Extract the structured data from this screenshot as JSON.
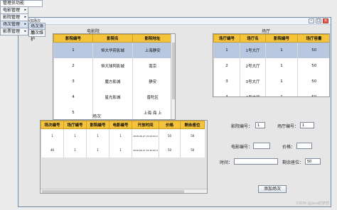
{
  "app_menu": {
    "title": "管理员功能",
    "items": [
      {
        "label": "电影管理",
        "has_sub": true
      },
      {
        "label": "影院管理",
        "has_sub": true
      },
      {
        "label": "场次管理",
        "has_sub": true
      },
      {
        "label": "影票管理",
        "has_sub": true
      }
    ],
    "submenu": [
      "场次添加",
      "场次维护"
    ]
  },
  "window": {
    "title": "添加场次"
  },
  "cinema_section": {
    "label": "电影院",
    "headers": [
      "影院编号",
      "影院名",
      "影院地址"
    ],
    "rows": [
      [
        "1",
        "恒大华府影城",
        "上海静安"
      ],
      [
        "2",
        "恒大球阿影城",
        "南京"
      ],
      [
        "3",
        "魔方影城",
        "静安"
      ],
      [
        "4",
        "星光影城",
        "普陀区"
      ],
      [
        "5",
        "",
        "上海 海 上"
      ]
    ],
    "selected_row": 0
  },
  "hall_section": {
    "label": "场厅",
    "headers": [
      "场厅编号",
      "场厅名",
      "影院编号",
      "场厅容量"
    ],
    "rows": [
      [
        "1",
        "1号大厅",
        "1",
        "50"
      ],
      [
        "2",
        "2号大厅",
        "1",
        "50"
      ],
      [
        "3",
        "3号大厅",
        "1",
        "50"
      ],
      [
        "4",
        "4号大厅",
        "1",
        "50"
      ]
    ],
    "selected_row": 0
  },
  "session_section": {
    "label": "场次",
    "headers": [
      "场次编号",
      "场厅编号",
      "影院编号",
      "电影编号",
      "开放时间",
      "价格",
      "剩余座位"
    ],
    "rows": [
      [
        "1",
        "1",
        "1",
        "1",
        "2018-06-27 15:00:00.0",
        "50",
        "50"
      ],
      [
        "46",
        "1",
        "1",
        "1",
        "2018-06-27 15:30:00.0",
        "50",
        "50"
      ]
    ]
  },
  "form": {
    "cinema_no_label": "影院编号：",
    "cinema_no_value": "1",
    "hall_no_label": "场厅编号：",
    "hall_no_value": "1",
    "movie_no_label": "电影编号：",
    "movie_no_value": "",
    "price_label": "价格：",
    "price_value": "",
    "time_label": "时间：",
    "time_value": "",
    "seats_label": "剩余座位：",
    "seats_value": "50",
    "submit_label": "添加场次"
  },
  "watermark": "CSDN @Java的梦想"
}
